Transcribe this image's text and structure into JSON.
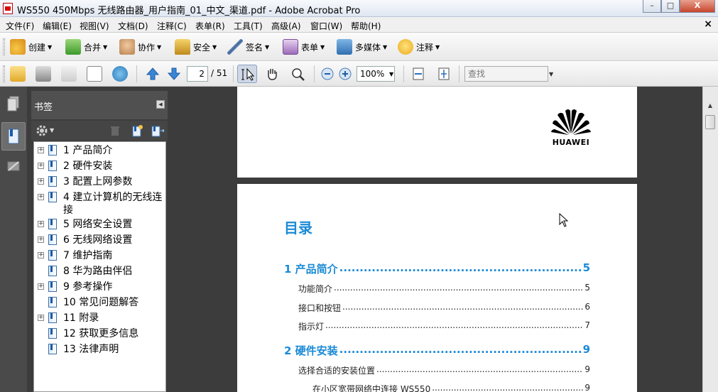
{
  "window": {
    "title": "WS550 450Mbps 无线路由器_用户指南_01_中文_渠道.pdf - Adobe Acrobat Pro",
    "minimize": "–",
    "maximize": "□",
    "close": "X"
  },
  "menu": {
    "items": [
      "文件(F)",
      "编辑(E)",
      "视图(V)",
      "文档(D)",
      "注释(C)",
      "表单(R)",
      "工具(T)",
      "高级(A)",
      "窗口(W)",
      "帮助(H)"
    ],
    "doc_close": "×"
  },
  "toolbar1": {
    "create": "创建",
    "combine": "合并",
    "collaborate": "协作",
    "secure": "安全",
    "sign": "签名",
    "forms": "表单",
    "multimedia": "多媒体",
    "comment": "注释"
  },
  "toolbar2": {
    "page_current": "2",
    "page_total": "/ 51",
    "zoom": "100%",
    "search_placeholder": "查找"
  },
  "bookmarks": {
    "header": "书签",
    "items": [
      {
        "label": "1 产品简介",
        "expandable": true
      },
      {
        "label": "2 硬件安装",
        "expandable": true
      },
      {
        "label": "3 配置上网参数",
        "expandable": true
      },
      {
        "label": "4 建立计算机的无线连接",
        "expandable": true
      },
      {
        "label": "5 网络安全设置",
        "expandable": true
      },
      {
        "label": "6 无线网络设置",
        "expandable": true
      },
      {
        "label": "7 维护指南",
        "expandable": true
      },
      {
        "label": "8 华为路由伴侣",
        "expandable": false
      },
      {
        "label": "9 参考操作",
        "expandable": true
      },
      {
        "label": "10 常见问题解答",
        "expandable": false
      },
      {
        "label": "11 附录",
        "expandable": true
      },
      {
        "label": "12 获取更多信息",
        "expandable": false
      },
      {
        "label": "13 法律声明",
        "expandable": false
      }
    ]
  },
  "document": {
    "logo_text": "HUAWEI",
    "toc_title": "目录",
    "toc": [
      {
        "level": 1,
        "text": "1  产品简介",
        "page": "5"
      },
      {
        "level": 2,
        "text": "功能简介",
        "page": "5"
      },
      {
        "level": 2,
        "text": "接口和按钮",
        "page": "6"
      },
      {
        "level": 2,
        "text": "指示灯",
        "page": "7"
      },
      {
        "level": 1,
        "text": "2  硬件安装",
        "page": "9"
      },
      {
        "level": 2,
        "text": "选择合适的安装位置",
        "page": "9"
      },
      {
        "level": 3,
        "text": "在小区宽带网络中连接 WS550",
        "page": "9"
      }
    ]
  },
  "colors": {
    "accent_blue": "#1a8ad6",
    "logo_red": "#000000",
    "panel_dark": "#3c3c3c"
  }
}
